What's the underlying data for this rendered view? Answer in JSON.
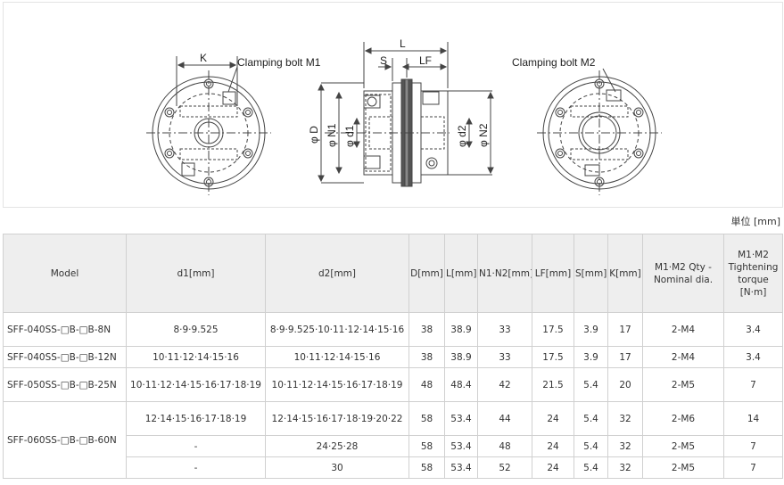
{
  "drawing": {
    "labels": {
      "k": "K",
      "clamp_m1": "Clamping bolt M1",
      "l": "L",
      "s": "S",
      "lf": "LF",
      "clamp_m2": "Clamping bolt M2",
      "phi_d": "φ D",
      "phi_n1": "φ N1",
      "phi_d1": "φ d1",
      "phi_d2": "φ d2",
      "phi_n2": "φ N2"
    }
  },
  "unit_label": "単位 [mm]",
  "table": {
    "headers": {
      "model": "Model",
      "d1": "d1[mm]",
      "d2": "d2[mm]",
      "D": "D[mm]",
      "L": "L[mm]",
      "N": "N1·N2[mm]",
      "LF": "LF[mm]",
      "S": "S[mm]",
      "K": "K[mm]",
      "M": "M1·M2 Qty - Nominal dia.",
      "T": "M1·M2 Tightening torque [N·m]"
    },
    "rows": [
      {
        "model": "SFF-040SS-□B-□B-8N",
        "d1": "8·9·9.525",
        "d2": "8·9·9.525·10·11·12·14·15·16",
        "D": "38",
        "L": "38.9",
        "N": "33",
        "LF": "17.5",
        "S": "3.9",
        "K": "17",
        "M": "2-M4",
        "T": "3.4"
      },
      {
        "model": "SFF-040SS-□B-□B-12N",
        "d1": "10·11·12·14·15·16",
        "d2": "10·11·12·14·15·16",
        "D": "38",
        "L": "38.9",
        "N": "33",
        "LF": "17.5",
        "S": "3.9",
        "K": "17",
        "M": "2-M4",
        "T": "3.4"
      },
      {
        "model": "SFF-050SS-□B-□B-25N",
        "d1": "10·11·12·14·15·16·17·18·19",
        "d2": "10·11·12·14·15·16·17·18·19",
        "D": "48",
        "L": "48.4",
        "N": "42",
        "LF": "21.5",
        "S": "5.4",
        "K": "20",
        "M": "2-M5",
        "T": "7"
      },
      {
        "model": "SFF-060SS-□B-□B-60N",
        "d1": "12·14·15·16·17·18·19",
        "d2": "12·14·15·16·17·18·19·20·22",
        "D": "58",
        "L": "53.4",
        "N": "44",
        "LF": "24",
        "S": "5.4",
        "K": "32",
        "M": "2-M6",
        "T": "14"
      },
      {
        "d1": "-",
        "d2": "24·25·28",
        "D": "58",
        "L": "53.4",
        "N": "48",
        "LF": "24",
        "S": "5.4",
        "K": "32",
        "M": "2-M5",
        "T": "7"
      },
      {
        "d1": "-",
        "d2": "30",
        "D": "58",
        "L": "53.4",
        "N": "52",
        "LF": "24",
        "S": "5.4",
        "K": "32",
        "M": "2-M5",
        "T": "7"
      }
    ]
  }
}
